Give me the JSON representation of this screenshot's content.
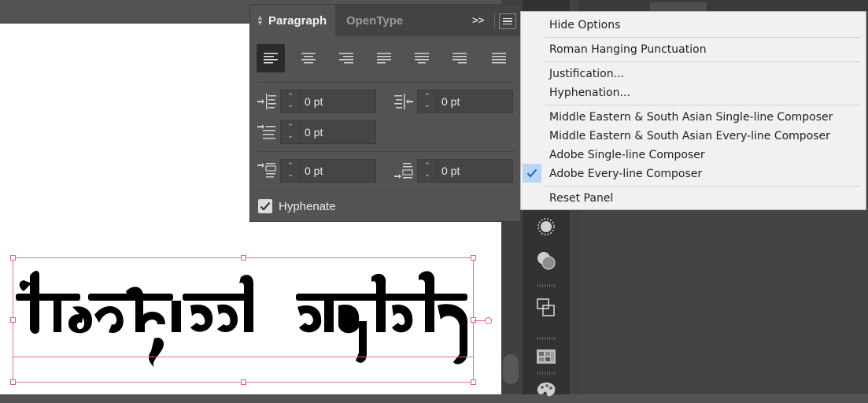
{
  "paragraph_panel": {
    "tabs": [
      "Paragraph",
      "OpenType"
    ],
    "expand_label": ">>",
    "alignment_buttons": [
      {
        "icon": "align-left-icon",
        "active": true
      },
      {
        "icon": "align-center-icon",
        "active": false
      },
      {
        "icon": "align-right-icon",
        "active": false
      },
      {
        "icon": "justify-last-left-icon",
        "active": false
      },
      {
        "icon": "justify-last-center-icon",
        "active": false
      },
      {
        "icon": "justify-last-right-icon",
        "active": false
      },
      {
        "icon": "justify-all-icon",
        "active": false
      }
    ],
    "fields": {
      "left_indent": "0 pt",
      "right_indent": "0 pt",
      "first_line_indent": "0 pt",
      "space_before": "0 pt",
      "space_after": "0 pt"
    },
    "hyphenate_label": "Hyphenate",
    "hyphenate_checked": true
  },
  "flyout_menu": {
    "items": [
      {
        "label": "Hide Options",
        "checked": false
      },
      {
        "label": "Roman Hanging Punctuation",
        "checked": false
      },
      {
        "label": "Justification...",
        "checked": false
      },
      {
        "label": "Hyphenation...",
        "checked": false
      },
      {
        "label": "Middle Eastern & South Asian Single-line Composer",
        "checked": false
      },
      {
        "label": "Middle Eastern & South Asian Every-line Composer",
        "checked": false
      },
      {
        "label": "Adobe Single-line Composer",
        "checked": false
      },
      {
        "label": "Adobe Every-line Composer",
        "checked": true
      },
      {
        "label": "Reset Panel",
        "checked": false
      }
    ]
  },
  "dock_icons": [
    "appearance-icon",
    "transparency-icon",
    "pathfinder-icon",
    "swatches-icon",
    "palette-icon"
  ],
  "colors": {
    "panel_bg": "#535353",
    "menu_bg": "#f1f1f1",
    "menu_check_bg": "#b9d6f4",
    "selection": "#e0787e"
  }
}
